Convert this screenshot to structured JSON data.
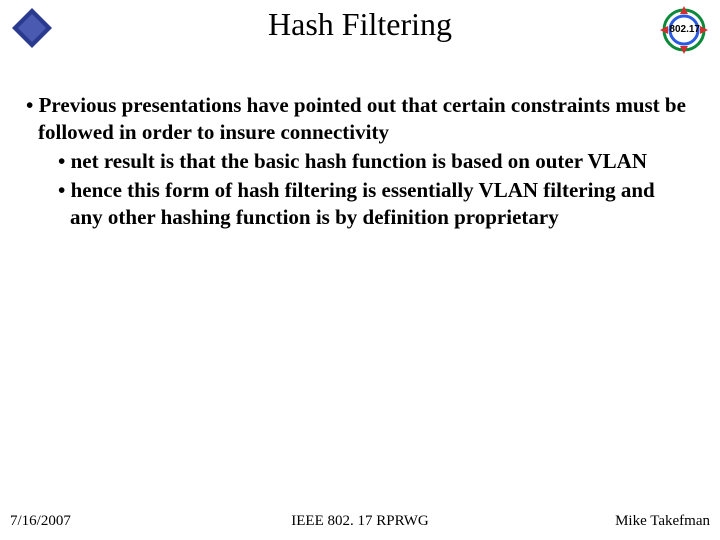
{
  "header": {
    "title": "Hash Filtering",
    "logo_right_label": "802.17"
  },
  "bullets": {
    "l1_a": "• Previous presentations have pointed out that certain constraints must be followed in order to insure connectivity",
    "l2_a": "• net result is that the basic hash function is based on outer VLAN",
    "l2_b": "• hence this form of hash filtering is essentially VLAN filtering and any other hashing function is by definition proprietary"
  },
  "footer": {
    "date": "7/16/2007",
    "center": "IEEE 802. 17 RPRWG",
    "author": "Mike Takefman"
  }
}
